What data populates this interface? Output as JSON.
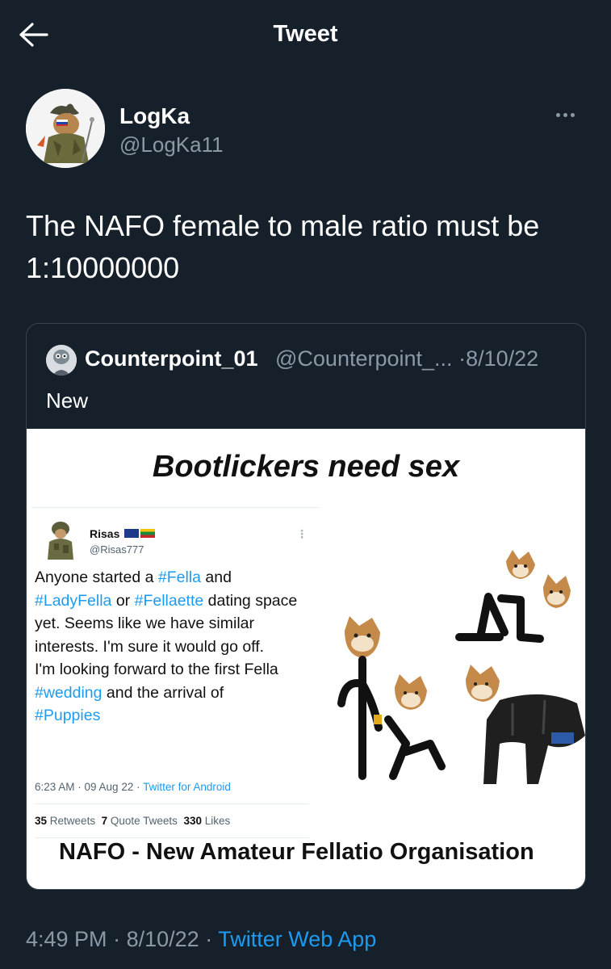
{
  "header": {
    "title": "Tweet",
    "back_icon": "arrow-left-icon"
  },
  "tweet": {
    "author_name": "LogKa",
    "author_handle": "@LogKa11",
    "more_icon": "ellipsis-icon",
    "text": "The NAFO female to male ratio must be 1:10000000",
    "time": "4:49 PM",
    "date": "8/10/22",
    "source": "Twitter Web App",
    "sep": "·"
  },
  "quote": {
    "name": "Counterpoint_01",
    "handle": "@Counterpoint_...",
    "date": "8/10/22",
    "sep": "·",
    "text": "New",
    "meme": {
      "title": "Bootlickers need sex",
      "bottom": "NAFO - New Amateur Fellatio Organisation",
      "inner_tweet": {
        "name": "Risas",
        "handle": "@Risas777",
        "text_1": "Anyone started a ",
        "tag_1": "#Fella",
        "text_2": " and",
        "tag_2": "#LadyFella",
        "text_3": " or ",
        "tag_3": "#Fellaette",
        "text_4": " dating space yet.  Seems like we have similar interests. I'm sure it would go off.",
        "text_5": "I'm looking forward to the first Fella ",
        "tag_4": "#wedding",
        "text_6": " and the arrival of",
        "tag_5": "#Puppies",
        "time": "6:23 AM · 09 Aug 22 · ",
        "app": "Twitter for Android",
        "retweets_count": "35",
        "retweets_label": "Retweets",
        "quotes_count": "7",
        "quotes_label": "Quote Tweets",
        "likes_count": "330",
        "likes_label": "Likes"
      }
    }
  },
  "colors": {
    "bg": "#15202b",
    "accent": "#1d9bf0",
    "muted": "#8b98a5"
  }
}
